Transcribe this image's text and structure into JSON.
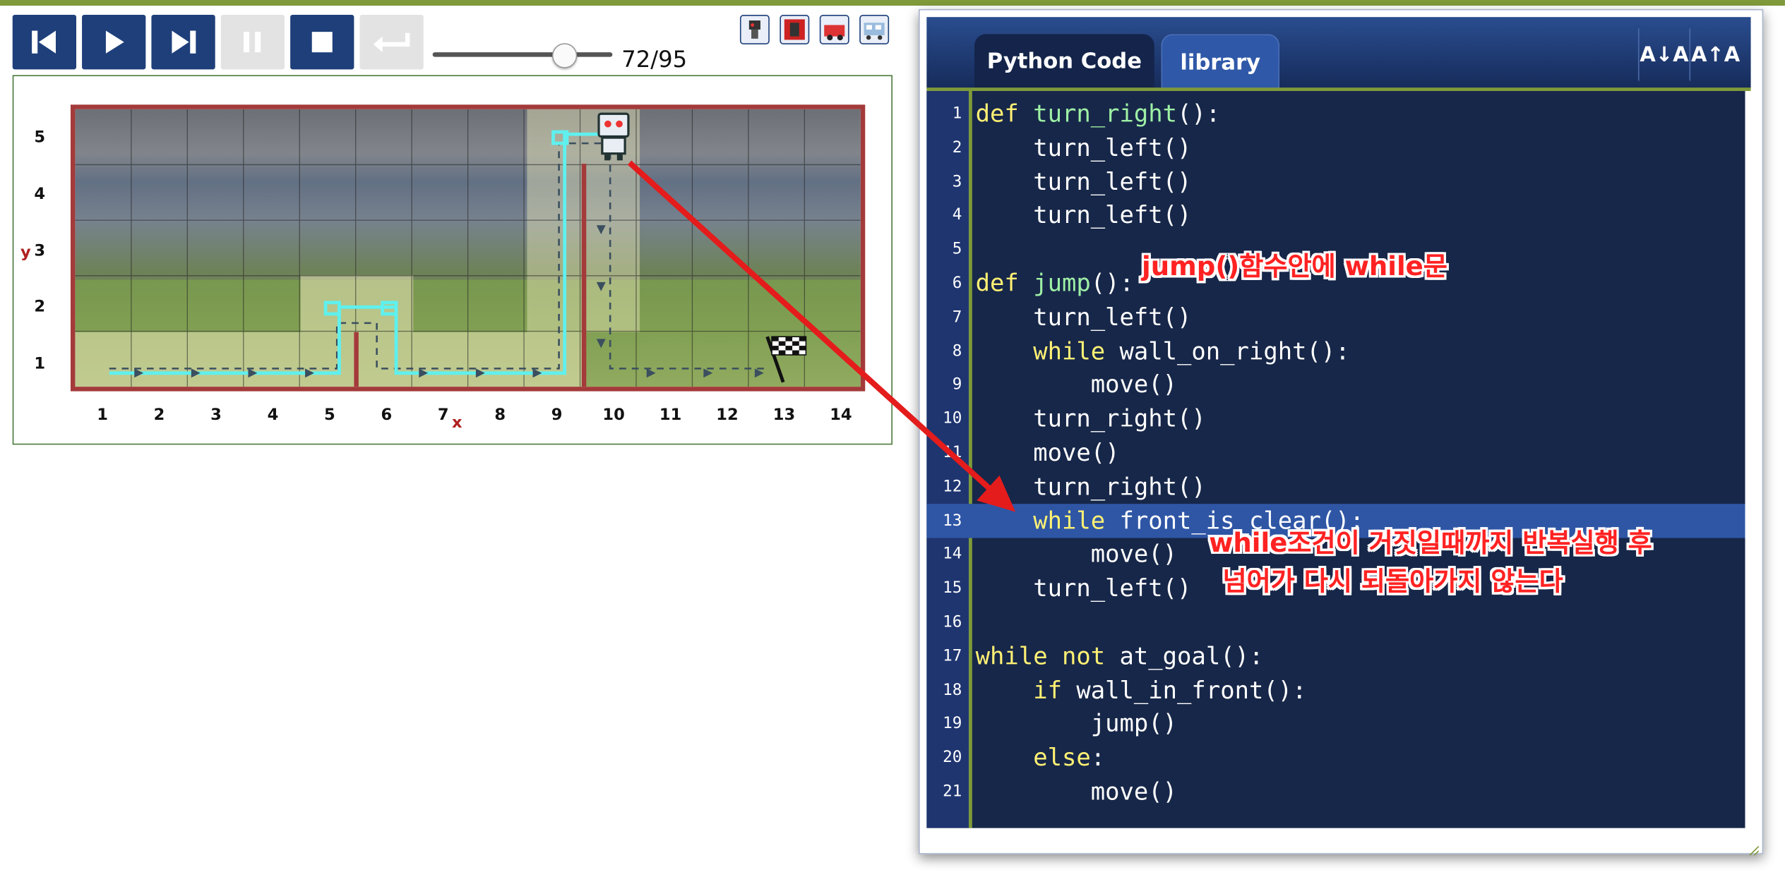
{
  "colors": {
    "accent_green": "#7e9a3a",
    "control_blue": "#1e3f7a",
    "code_bg": "#172749",
    "keyword_yellow": "#fff174",
    "function_green": "#9ef0a5",
    "highlight_line": "#2f56a5",
    "annotation_red": "#ff2222",
    "wall_red": "#a43a3a",
    "trace_cyan": "#5ff0ee"
  },
  "toolbar": {
    "buttons": [
      {
        "name": "step-first-button",
        "icon": "skip-back-icon",
        "enabled": true
      },
      {
        "name": "play-button",
        "icon": "play-icon",
        "enabled": true
      },
      {
        "name": "step-forward-button",
        "icon": "skip-forward-icon",
        "enabled": true
      },
      {
        "name": "pause-button",
        "icon": "pause-icon",
        "enabled": false
      },
      {
        "name": "stop-button",
        "icon": "stop-icon",
        "enabled": true
      },
      {
        "name": "return-button",
        "icon": "return-icon",
        "enabled": false
      }
    ],
    "step_current": 72,
    "step_total": 95,
    "step_label": "72/95",
    "world_icons": [
      "robot-icon",
      "robot-film-icon",
      "robot-car-icon",
      "robot-train-icon"
    ]
  },
  "world": {
    "x_labels": [
      "1",
      "2",
      "3",
      "4",
      "5",
      "6",
      "7",
      "8",
      "9",
      "10",
      "11",
      "12",
      "13",
      "14"
    ],
    "y_labels": [
      "5",
      "4",
      "3",
      "2",
      "1"
    ],
    "x_axis_letter": "x",
    "y_axis_letter": "y",
    "goal_icon": "checkered-flag-icon",
    "robot_icon": "robot-icon"
  },
  "editor": {
    "tabs": [
      {
        "label": "Python Code",
        "active": true
      },
      {
        "label": "library",
        "active": false
      }
    ],
    "font_decrease_label": "A↓A",
    "font_increase_label": "A↑A",
    "highlighted_line": 13,
    "lines": [
      {
        "n": "1",
        "code": "def turn_right():"
      },
      {
        "n": "2",
        "code": "    turn_left()"
      },
      {
        "n": "3",
        "code": "    turn_left()"
      },
      {
        "n": "4",
        "code": "    turn_left()"
      },
      {
        "n": "5",
        "code": ""
      },
      {
        "n": "6",
        "code": "def jump():"
      },
      {
        "n": "7",
        "code": "    turn_left()"
      },
      {
        "n": "8",
        "code": "    while wall_on_right():"
      },
      {
        "n": "9",
        "code": "        move()"
      },
      {
        "n": "10",
        "code": "    turn_right()"
      },
      {
        "n": "11",
        "code": "    move()"
      },
      {
        "n": "12",
        "code": "    turn_right()"
      },
      {
        "n": "13",
        "code": "    while front_is_clear():"
      },
      {
        "n": "14",
        "code": "        move()"
      },
      {
        "n": "15",
        "code": "    turn_left()"
      },
      {
        "n": "16",
        "code": ""
      },
      {
        "n": "17",
        "code": "while not at_goal():"
      },
      {
        "n": "18",
        "code": "    if wall_in_front():"
      },
      {
        "n": "19",
        "code": "        jump()"
      },
      {
        "n": "20",
        "code": "    else:"
      },
      {
        "n": "21",
        "code": "        move()"
      }
    ]
  },
  "annotations": {
    "note_jump": "jump()함수안에 while문",
    "note_while_line1": "while조건이 거짓일때까지 반복실행 후",
    "note_while_line2": "넘어가 다시 되돌아가지 않는다"
  }
}
